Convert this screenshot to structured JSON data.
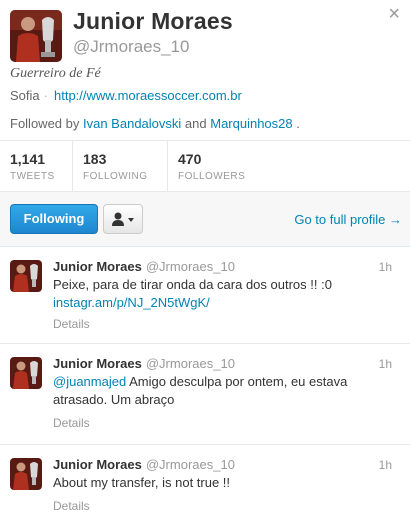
{
  "profile": {
    "name": "Junior Moraes",
    "handle": "@Jrmoraes_10",
    "bio": "Guerreiro de Fé",
    "location": "Sofia",
    "separator": "·",
    "website": "http://www.moraessoccer.com.br",
    "followed_by_prefix": "Followed by",
    "followed_by_1": "Ivan Bandalovski",
    "followed_by_and": "and",
    "followed_by_2": "Marquinhos28",
    "followed_by_suffix": "."
  },
  "close_label": "×",
  "stats": [
    {
      "value": "1,141",
      "label": "TWEETS"
    },
    {
      "value": "183",
      "label": "FOLLOWING"
    },
    {
      "value": "470",
      "label": "FOLLOWERS"
    }
  ],
  "actions": {
    "following_label": "Following",
    "full_profile_label": "Go to full profile →",
    "user_menu_icon": "person-dropdown-icon"
  },
  "tweets": [
    {
      "name": "Junior Moraes",
      "handle": "@Jrmoraes_10",
      "time": "1h",
      "text": "Peixe, para de tirar onda da cara dos outros !! :0",
      "link": "instagr.am/p/NJ_2N5tWgK/",
      "details": "Details"
    },
    {
      "name": "Junior Moraes",
      "handle": "@Jrmoraes_10",
      "time": "1h",
      "mention": "@juanmajed",
      "text": " Amigo desculpa por ontem, eu estava atrasado. Um abraço",
      "details": "Details"
    },
    {
      "name": "Junior Moraes",
      "handle": "@Jrmoraes_10",
      "time": "1h",
      "text": "About my transfer, is not true !!",
      "details": "Details"
    }
  ],
  "colors": {
    "link": "#0084b4",
    "following_button": "#1e86cf",
    "muted": "#999999"
  }
}
